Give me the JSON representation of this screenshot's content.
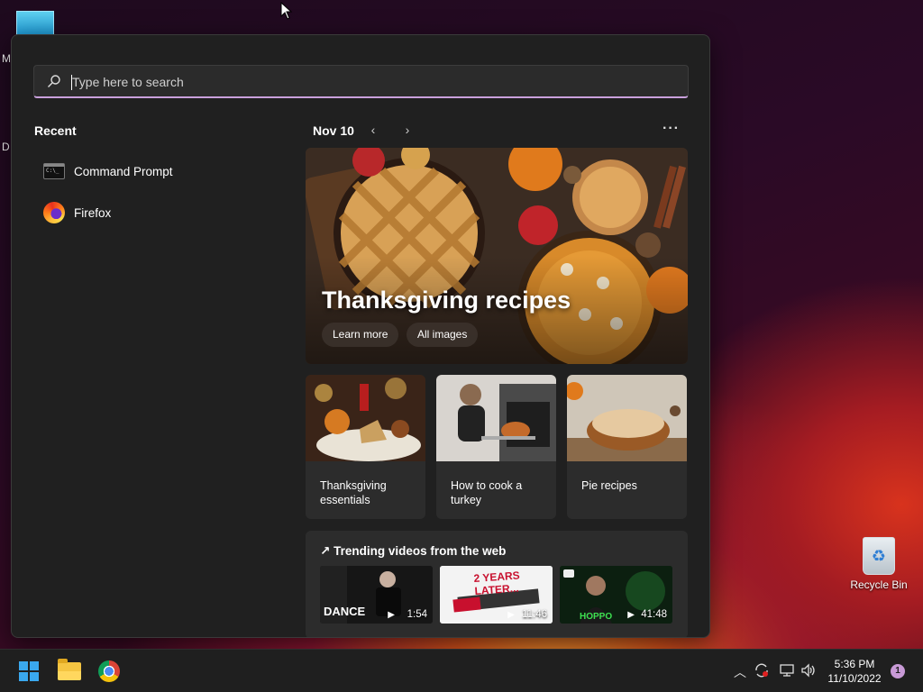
{
  "desktop": {
    "side_letters": [
      "M",
      "D"
    ],
    "recycle_bin_label": "Recycle Bin"
  },
  "start_menu": {
    "search": {
      "placeholder": "Type here to search",
      "value": ""
    },
    "recent": {
      "title": "Recent",
      "items": [
        {
          "label": "Command Prompt",
          "icon": "command-prompt-icon"
        },
        {
          "label": "Firefox",
          "icon": "firefox-icon"
        }
      ]
    },
    "widgets": {
      "date": "Nov 10",
      "prev_icon": "chevron-left-icon",
      "next_icon": "chevron-right-icon",
      "more_label": "···",
      "hero": {
        "title": "Thanksgiving recipes",
        "buttons": [
          "Learn more",
          "All images"
        ]
      },
      "cards": [
        {
          "caption": "Thanksgiving essentials"
        },
        {
          "caption": "How to cook a turkey"
        },
        {
          "caption": "Pie recipes"
        }
      ],
      "trending": {
        "title": "Trending videos from the web",
        "icon": "trending-arrow-icon",
        "videos": [
          {
            "duration": "1:54",
            "overlay": "DANCE"
          },
          {
            "duration": "11:46",
            "overlay": "2 YEARS LATER..."
          },
          {
            "duration": "41:48",
            "overlay": "HOPPO"
          }
        ]
      }
    }
  },
  "taskbar": {
    "apps": [
      "start-button",
      "file-explorer",
      "chrome"
    ],
    "clock": {
      "time": "5:36 PM",
      "date": "11/10/2022"
    },
    "notification_count": "1"
  },
  "colors": {
    "search_underline": "#c9a0dc",
    "panel_bg": "#202020",
    "taskbar_bg": "#1f1f1f",
    "accent": "#3aa8ee"
  }
}
